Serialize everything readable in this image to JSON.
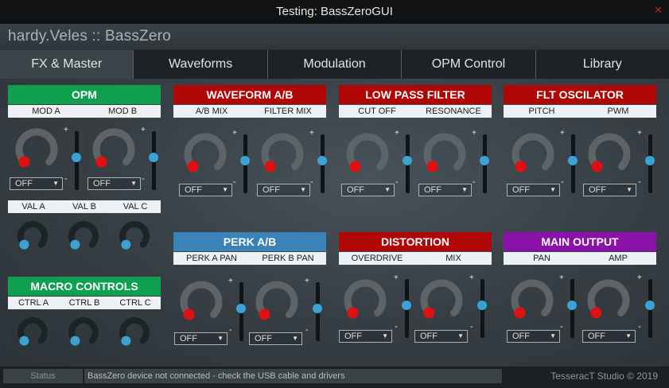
{
  "window": {
    "title": "Testing: BassZeroGUI",
    "close_glyph": "✕"
  },
  "brand": "hardy.Veles :: BassZero",
  "tabs": [
    {
      "label": "FX & Master",
      "active": true
    },
    {
      "label": "Waveforms",
      "active": false
    },
    {
      "label": "Modulation",
      "active": false
    },
    {
      "label": "OPM Control",
      "active": false
    },
    {
      "label": "Library",
      "active": false
    }
  ],
  "colors": {
    "green": "#0ea04f",
    "red": "#b00606",
    "blue": "#3a82b8",
    "purple": "#8a12a8",
    "knob_track": "#5d6366",
    "knob_dot_red": "#e01010",
    "knob_dot_blue": "#3aa3d6"
  },
  "icons": {
    "dropdown_caret": "chevron-down-icon",
    "close": "close-icon"
  },
  "sections": {
    "opm": {
      "title": "OPM",
      "labels": [
        "MOD A",
        "MOD B"
      ],
      "dropdowns": [
        "OFF",
        "OFF"
      ],
      "sub_labels": [
        "VAL A",
        "VAL B",
        "VAL C"
      ],
      "slider_plus": "+",
      "slider_minus": "-"
    },
    "macro": {
      "title": "MACRO CONTROLS",
      "labels": [
        "CTRL A",
        "CTRL B",
        "CTRL C"
      ]
    },
    "waveform": {
      "title": "WAVEFORM A/B",
      "labels": [
        "A/B MIX",
        "FILTER MIX"
      ],
      "dropdowns": [
        "OFF",
        "OFF"
      ]
    },
    "lowpass": {
      "title": "LOW PASS FILTER",
      "labels": [
        "CUT OFF",
        "RESONANCE"
      ],
      "dropdowns": [
        "OFF",
        "OFF"
      ]
    },
    "fltosc": {
      "title": "FLT OSCILATOR",
      "labels": [
        "PITCH",
        "PWM"
      ],
      "dropdowns": [
        "OFF",
        "OFF"
      ]
    },
    "perk": {
      "title": "PERK A/B",
      "labels": [
        "PERK A PAN",
        "PERK B PAN"
      ],
      "dropdowns": [
        "OFF",
        "OFF"
      ]
    },
    "distortion": {
      "title": "DISTORTION",
      "labels": [
        "OVERDRIVE",
        "MIX"
      ],
      "dropdowns": [
        "OFF",
        "OFF"
      ]
    },
    "mainout": {
      "title": "MAIN OUTPUT",
      "labels": [
        "PAN",
        "AMP"
      ],
      "dropdowns": [
        "OFF",
        "OFF"
      ]
    }
  },
  "status": {
    "label": "Status",
    "message": "BassZero device not connected - check the USB cable and drivers"
  },
  "footer": "TesseracT Studio © 2019"
}
